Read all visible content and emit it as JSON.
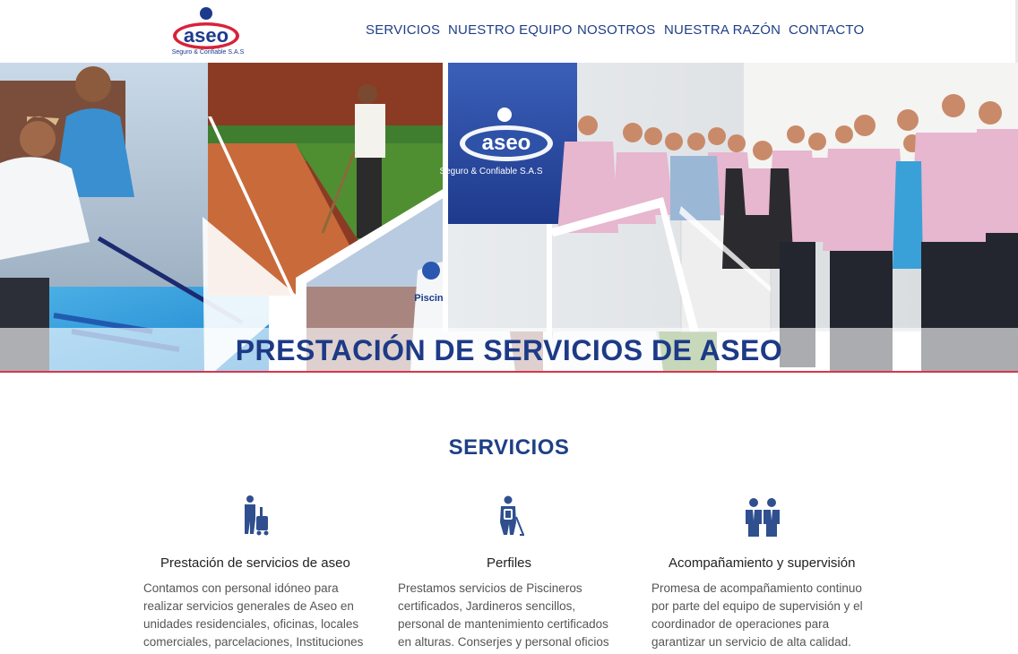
{
  "brand": {
    "logo_text": "aseo",
    "logo_tagline": "Seguro & Confiable S.A.S",
    "colors": {
      "primary": "#1f3f86",
      "accent": "#d8354a"
    }
  },
  "nav": {
    "items": [
      {
        "label": "SERVICIOS"
      },
      {
        "label": "NUESTRO EQUIPO"
      },
      {
        "label": "NOSOTROS"
      },
      {
        "label": "NUESTRA RAZÓN"
      },
      {
        "label": "CONTACTO"
      }
    ]
  },
  "hero": {
    "title": "PRESTACIÓN DE SERVICIOS DE ASEO",
    "sign_text": "aseo",
    "sign_tagline": "Seguro & Confiable S.A.S",
    "shirt_text": "Piscinero"
  },
  "services": {
    "title": "SERVICIOS",
    "cards": [
      {
        "icon": "cleaning-cart-icon",
        "title": "Prestación de servicios de aseo",
        "lines": [
          "Contamos con personal idóneo para",
          "realizar servicios generales de Aseo en",
          "unidades residenciales, oficinas, locales",
          "comerciales, parcelaciones, Instituciones"
        ]
      },
      {
        "icon": "worker-profile-icon",
        "title": "Perfiles",
        "lines": [
          "Prestamos servicios de Piscineros",
          "certificados, Jardineros sencillos,",
          "personal de mantenimiento certificados",
          "en alturas. Conserjes y personal oficios"
        ]
      },
      {
        "icon": "team-supervision-icon",
        "title": "Acompañamiento y supervisión",
        "lines": [
          "Promesa de acompañamiento continuo",
          "por parte del equipo de supervisión y el",
          "coordinador de operaciones para",
          "garantizar un servicio de alta calidad."
        ]
      }
    ]
  }
}
